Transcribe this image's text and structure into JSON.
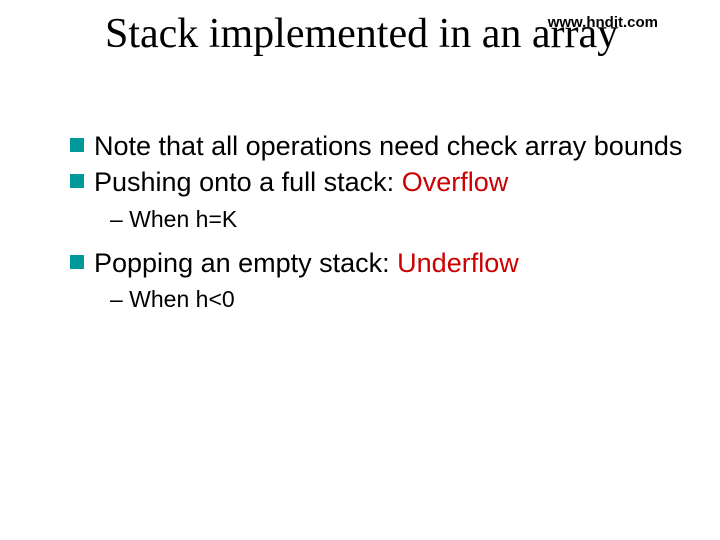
{
  "watermark": "www.hndit.com",
  "title": "Stack implemented in an array",
  "bullets": {
    "b0": {
      "text": "Note that all operations need check array bounds"
    },
    "b1": {
      "prefix": "Pushing onto a full stack: ",
      "highlight": "Overflow"
    },
    "sub1": "– When h=K",
    "b2": {
      "prefix": "Popping an empty stack:  ",
      "highlight": "Underflow"
    },
    "sub2": "– When h<0"
  }
}
